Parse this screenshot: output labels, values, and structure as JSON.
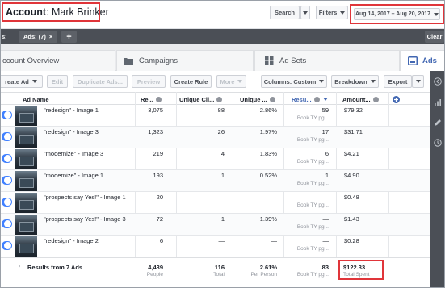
{
  "header": {
    "account_label": "Account",
    "account_name": "Mark Brinker",
    "search_label": "Search",
    "filters_label": "Filters",
    "date_range": "Aug 14, 2017 – Aug 20, 2017"
  },
  "dark_bar": {
    "left_fragment": "s:",
    "ads_filter": "Ads: (7)",
    "close_glyph": "×",
    "add_glyph": "+",
    "clear_label": "Clear"
  },
  "tabs": [
    {
      "label": "ccount Overview",
      "icon": "",
      "active": false
    },
    {
      "label": "Campaigns",
      "icon": "folder-icon",
      "active": false
    },
    {
      "label": "Ad Sets",
      "icon": "grid-icon",
      "active": false
    },
    {
      "label": "Ads",
      "icon": "ad-icon",
      "active": true
    }
  ],
  "toolbar": {
    "create_ad": "reate Ad",
    "edit": "Edit",
    "duplicate": "Duplicate Ads...",
    "preview": "Preview",
    "create_rule": "Create Rule",
    "more": "More",
    "columns": "Columns: Custom",
    "breakdown": "Breakdown",
    "export": "Export"
  },
  "table": {
    "columns": [
      "Ad Name",
      "Re...",
      "Unique Cli...",
      "Unique ...",
      "Resu...",
      "Amount..."
    ],
    "rows": [
      {
        "name": "\"redesign\" - Image 1",
        "reach": "3,075",
        "unique_clicks": "88",
        "unique_ctr": "2.86%",
        "results": "59",
        "result_sub": "Book TY pg...",
        "amount": "$79.32"
      },
      {
        "name": "\"redesign\" - Image 3",
        "reach": "1,323",
        "unique_clicks": "26",
        "unique_ctr": "1.97%",
        "results": "17",
        "result_sub": "Book TY pg...",
        "amount": "$31.71"
      },
      {
        "name": "\"modernize\" - Image 3",
        "reach": "219",
        "unique_clicks": "4",
        "unique_ctr": "1.83%",
        "results": "6",
        "result_sub": "Book TY pg...",
        "amount": "$4.21"
      },
      {
        "name": "\"modernize\" - Image 1",
        "reach": "193",
        "unique_clicks": "1",
        "unique_ctr": "0.52%",
        "results": "1",
        "result_sub": "Book TY pg...",
        "amount": "$4.90"
      },
      {
        "name": "\"prospects say Yes!\" - Image 1",
        "reach": "20",
        "unique_clicks": "—",
        "unique_ctr": "—",
        "results": "—",
        "result_sub": "Book TY pg...",
        "amount": "$0.48"
      },
      {
        "name": "\"prospects say Yes!\" - Image 3",
        "reach": "72",
        "unique_clicks": "1",
        "unique_ctr": "1.39%",
        "results": "—",
        "result_sub": "Book TY pg...",
        "amount": "$1.43"
      },
      {
        "name": "\"redesign\" - Image 2",
        "reach": "6",
        "unique_clicks": "—",
        "unique_ctr": "—",
        "results": "—",
        "result_sub": "Book TY pg...",
        "amount": "$0.28"
      }
    ],
    "footer": {
      "label": "Results from 7 Ads",
      "reach": "4,439",
      "reach_sub": "People",
      "unique_clicks": "116",
      "unique_clicks_sub": "Total",
      "unique_ctr": "2.61%",
      "unique_ctr_sub": "Per Person",
      "results": "83",
      "results_sub": "Book TY pg...",
      "amount": "$122.33",
      "amount_sub": "Total Spent"
    }
  },
  "colors": {
    "accent": "#4267b2",
    "highlight": "#e0353a",
    "dark_bar": "#4b4f56",
    "toggle_on": "#4080ff"
  }
}
